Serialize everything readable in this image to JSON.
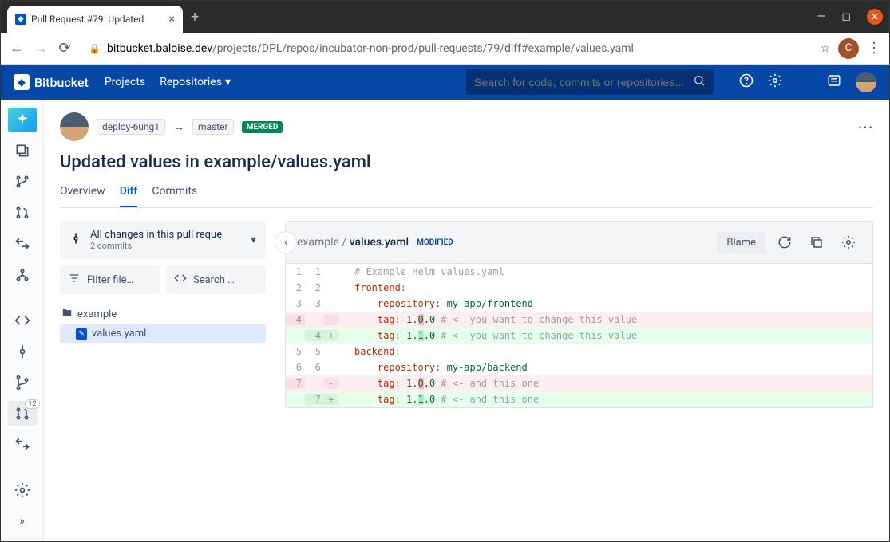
{
  "browser": {
    "tab_title": "Pull Request #79: Updated",
    "url_host": "bitbucket.baloise.dev",
    "url_path": "/projects/DPL/repos/incubator-non-prod/pull-requests/79/diff#example/values.yaml",
    "profile_initial": "C"
  },
  "header": {
    "brand": "Bitbucket",
    "nav_projects": "Projects",
    "nav_repos": "Repositories",
    "search_placeholder": "Search for code, commits or repositories..."
  },
  "sidebar": {
    "badge_count": "12"
  },
  "pr": {
    "source_branch": "deploy-6ung1",
    "target_branch": "master",
    "status": "MERGED",
    "title": "Updated values in example/values.yaml",
    "tabs": {
      "overview": "Overview",
      "diff": "Diff",
      "commits": "Commits"
    },
    "changes_title": "All changes in this pull reque",
    "changes_sub": "2 commits",
    "filter_label": "Filter file…",
    "search_label": "Search …",
    "folder": "example",
    "file": "values.yaml"
  },
  "diff": {
    "path_folder": "example",
    "path_file": "values.yaml",
    "mod_label": "MODIFIED",
    "blame": "Blame",
    "lines": [
      {
        "oldNum": "1",
        "newNum": "1",
        "marker": "",
        "type": "ctx",
        "code": "# Example Helm values.yaml",
        "kind": "comment"
      },
      {
        "oldNum": "2",
        "newNum": "2",
        "marker": "",
        "type": "ctx",
        "key": "frontend",
        "colon": ":"
      },
      {
        "oldNum": "3",
        "newNum": "3",
        "marker": "",
        "type": "ctx",
        "indent": "    ",
        "key": "repository",
        "colon": ": ",
        "val": "my-app/frontend"
      },
      {
        "oldNum": "4",
        "newNum": "",
        "marker": "-",
        "type": "removed",
        "indent": "    ",
        "key": "tag",
        "colon": ": ",
        "valPrefix": "1.",
        "valMark": "0",
        "valSuffix": ".0",
        "comment": " # <- you want to change this value"
      },
      {
        "oldNum": "",
        "newNum": "4",
        "marker": "+",
        "type": "added",
        "indent": "    ",
        "key": "tag",
        "colon": ": ",
        "valPrefix": "1.",
        "valMark": "1",
        "valSuffix": ".0",
        "comment": " # <- you want to change this value"
      },
      {
        "oldNum": "5",
        "newNum": "5",
        "marker": "",
        "type": "ctx",
        "key": "backend",
        "colon": ":"
      },
      {
        "oldNum": "6",
        "newNum": "6",
        "marker": "",
        "type": "ctx",
        "indent": "    ",
        "key": "repository",
        "colon": ": ",
        "val": "my-app/backend"
      },
      {
        "oldNum": "7",
        "newNum": "",
        "marker": "-",
        "type": "removed",
        "indent": "    ",
        "key": "tag",
        "colon": ": ",
        "valPrefix": "1.",
        "valMark": "0",
        "valSuffix": ".0",
        "comment": " # <- and this one"
      },
      {
        "oldNum": "",
        "newNum": "7",
        "marker": "+",
        "type": "added",
        "indent": "    ",
        "key": "tag",
        "colon": ": ",
        "valPrefix": "1.",
        "valMark": "1",
        "valSuffix": ".0",
        "comment": " # <- and this one"
      }
    ]
  }
}
